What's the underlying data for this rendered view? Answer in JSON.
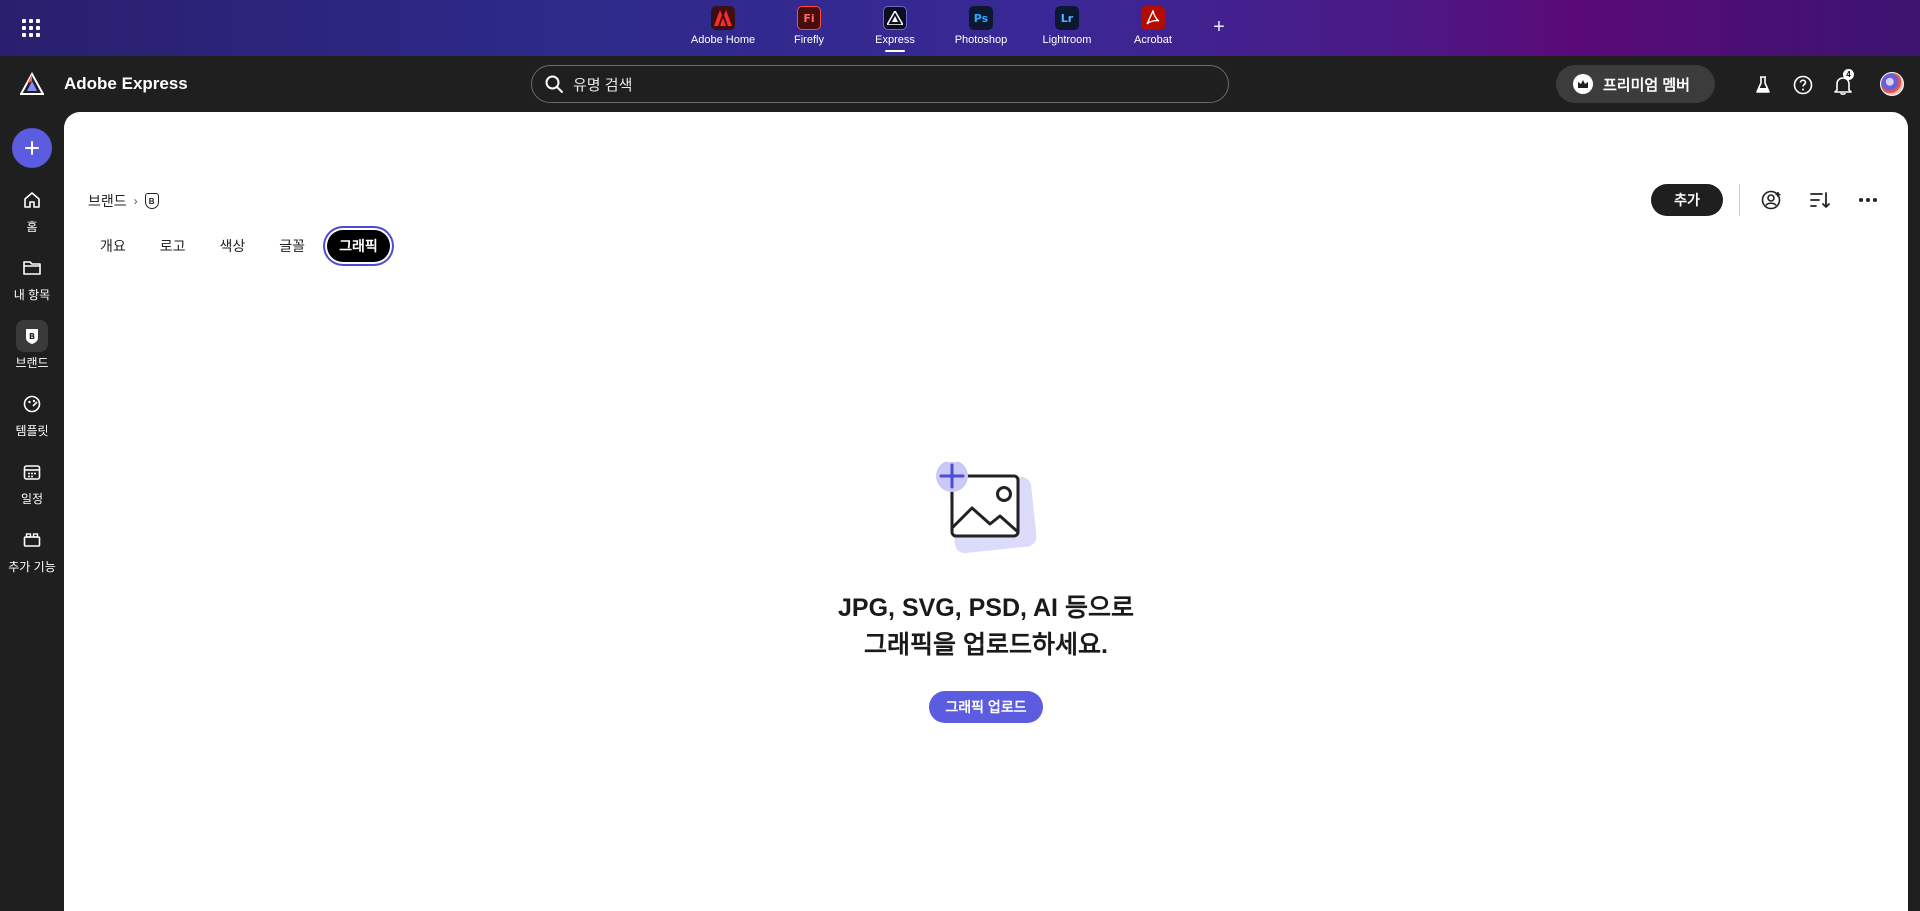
{
  "appbar": {
    "apps": [
      {
        "label": "Adobe Home",
        "icon": "adobe-home-icon",
        "glyph": "",
        "color": "#4a1a1a"
      },
      {
        "label": "Firefly",
        "icon": "firefly-icon",
        "glyph": "Fi",
        "color": "#5a1010"
      },
      {
        "label": "Express",
        "icon": "express-icon",
        "glyph": "",
        "color": "#111133"
      },
      {
        "label": "Photoshop",
        "icon": "photoshop-icon",
        "glyph": "Ps",
        "color": "#0c1d3a"
      },
      {
        "label": "Lightroom",
        "icon": "lightroom-icon",
        "glyph": "Lr",
        "color": "#0c1d3a"
      },
      {
        "label": "Acrobat",
        "icon": "acrobat-icon",
        "glyph": "",
        "color": "#5a1010"
      }
    ],
    "active_app": "Express"
  },
  "header": {
    "brand_name": "Adobe Express",
    "search_placeholder": "유명 검색",
    "premium_label": "프리미엄 멤버",
    "notification_count": "4"
  },
  "rail": {
    "items": [
      {
        "label": "홈",
        "icon": "home-icon"
      },
      {
        "label": "내 항목",
        "icon": "folder-icon"
      },
      {
        "label": "브랜드",
        "icon": "brand-icon"
      },
      {
        "label": "템플릿",
        "icon": "template-icon"
      },
      {
        "label": "일정",
        "icon": "calendar-icon"
      },
      {
        "label": "추가 기능",
        "icon": "addons-icon"
      }
    ],
    "active": "브랜드"
  },
  "main": {
    "breadcrumb": {
      "root": "브랜드",
      "current_badge": "B"
    },
    "tabs": [
      "개요",
      "로고",
      "색상",
      "글꼴",
      "그래픽"
    ],
    "active_tab": "그래픽",
    "add_label": "추가",
    "empty_state": {
      "line1": "JPG, SVG, PSD, AI 등으로",
      "line2": "그래픽을 업로드하세요.",
      "upload_label": "그래픽 업로드"
    }
  },
  "colors": {
    "accent": "#5c5ce0",
    "dark_bg": "#1f1f1f"
  }
}
